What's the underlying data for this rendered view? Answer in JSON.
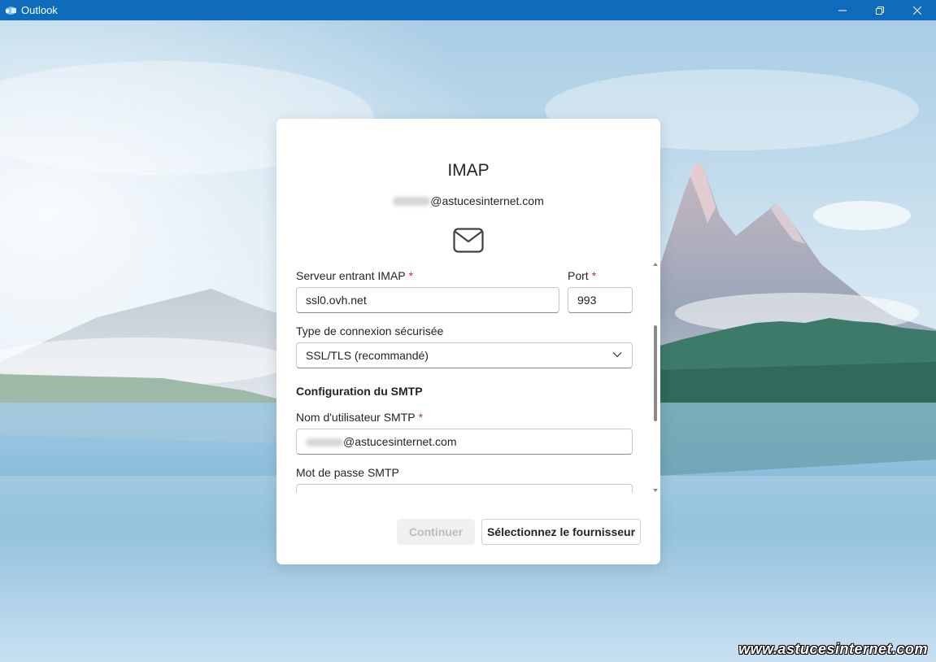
{
  "window": {
    "title": "Outlook",
    "accent_color": "#0f6cbd"
  },
  "dialog": {
    "heading": "IMAP",
    "account_domain": "@astucesinternet.com",
    "icon": "mail-icon",
    "incoming_server": {
      "label": "Serveur entrant IMAP",
      "required_mark": "*",
      "value": "ssl0.ovh.net"
    },
    "port": {
      "label": "Port",
      "required_mark": "*",
      "value": "993"
    },
    "connection_type": {
      "label": "Type de connexion sécurisée",
      "value": "SSL/TLS (recommandé)"
    },
    "smtp_section": {
      "heading": "Configuration du SMTP"
    },
    "smtp_username": {
      "label": "Nom d'utilisateur SMTP",
      "required_mark": "*",
      "value_domain": "@astucesinternet.com"
    },
    "smtp_password": {
      "label": "Mot de passe SMTP",
      "value": ""
    },
    "buttons": {
      "continue": "Continuer",
      "select_provider": "Sélectionnez le fournisseur"
    }
  },
  "watermark": "www.astucesinternet.com"
}
